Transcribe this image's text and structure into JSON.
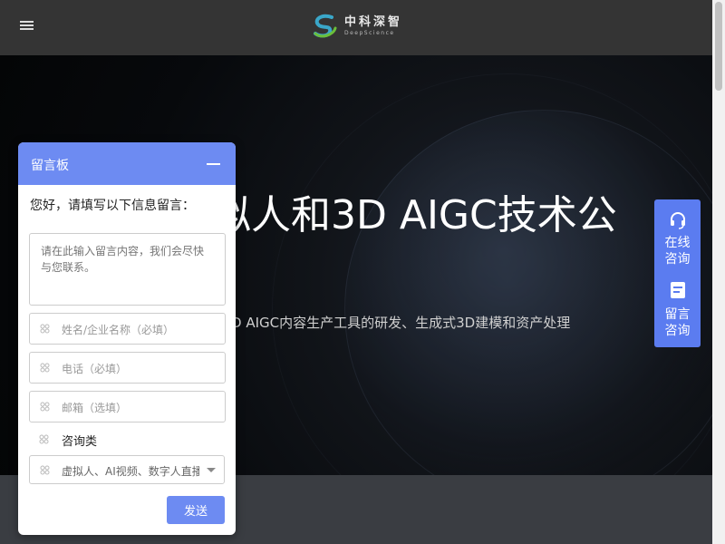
{
  "header": {
    "menu_icon": "hamburger-menu-icon",
    "logo_cn": "中科深智",
    "logo_en": "DeepScience"
  },
  "hero": {
    "title": "拟人和3D AIGC技术公",
    "subtitle": "D AIGC内容生产工具的研发、生成式3D建模和资产处理"
  },
  "side_panel": {
    "color": "#5b7cf0",
    "items": [
      {
        "label": "在线咨询",
        "icon": "headset-icon"
      },
      {
        "label": "留言咨询",
        "icon": "document-icon"
      }
    ]
  },
  "chat": {
    "title": "留言板",
    "header_color": "#6d8bf2",
    "intro": "您好，请填写以下信息留言：",
    "message_placeholder": "请在此输入留言内容，我们会尽快与您联系。",
    "fields": [
      {
        "placeholder": "姓名/企业名称（必填）"
      },
      {
        "placeholder": "电话（必填）"
      },
      {
        "placeholder": "邮箱（选填）"
      }
    ],
    "inquiry_label": "咨询类",
    "inquiry_selected": "虚拟人、AI视频、数字人直播/智能交互",
    "send_label": "发送"
  }
}
